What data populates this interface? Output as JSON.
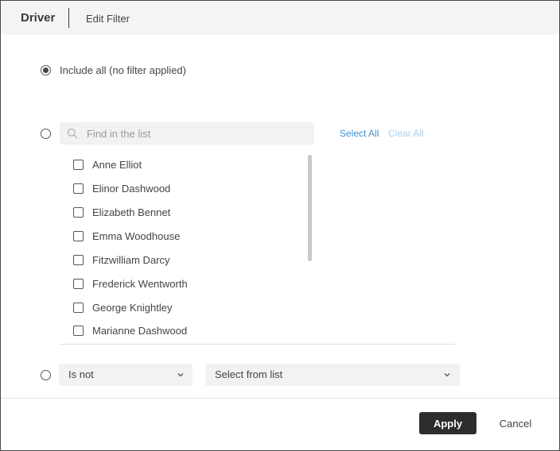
{
  "header": {
    "title": "Driver",
    "subtitle": "Edit Filter"
  },
  "options": {
    "include_all_label": "Include all (no filter applied)",
    "selected": "include_all"
  },
  "search": {
    "placeholder": "Find in the list",
    "value": "",
    "select_all_label": "Select All",
    "clear_all_label": "Clear All"
  },
  "list": {
    "items": [
      {
        "label": "Anne Elliot",
        "checked": false
      },
      {
        "label": "Elinor Dashwood",
        "checked": false
      },
      {
        "label": "Elizabeth Bennet",
        "checked": false
      },
      {
        "label": "Emma Woodhouse",
        "checked": false
      },
      {
        "label": "Fitzwilliam Darcy",
        "checked": false
      },
      {
        "label": "Frederick Wentworth",
        "checked": false
      },
      {
        "label": "George Knightley",
        "checked": false
      },
      {
        "label": "Marianne Dashwood",
        "checked": false
      }
    ]
  },
  "condition": {
    "operator": "Is not",
    "value_placeholder": "Select from list"
  },
  "footer": {
    "apply_label": "Apply",
    "cancel_label": "Cancel"
  },
  "colors": {
    "link": "#3d8ecf",
    "link_disabled": "#a9d1ef",
    "primary_button": "#2d2d2d",
    "header_bg": "#f4f4f6"
  },
  "icons": {
    "search": "search-icon",
    "chevron": "chevron-down-icon"
  }
}
